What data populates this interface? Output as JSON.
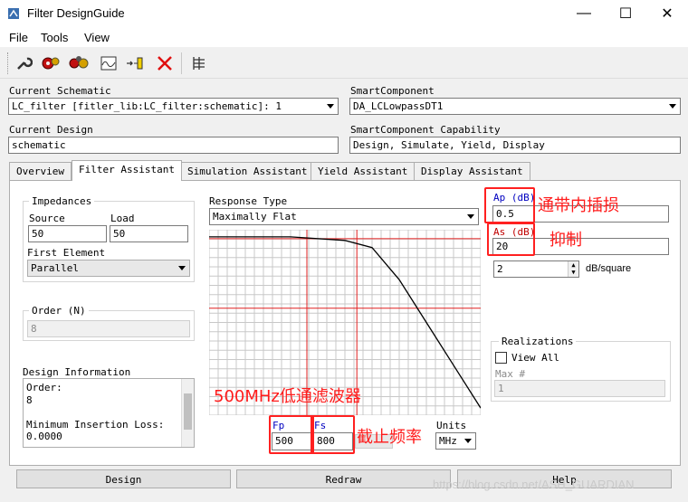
{
  "window": {
    "title": "Filter DesignGuide",
    "minimize": "—",
    "maximize": "☐",
    "close": "✕"
  },
  "menu": {
    "file": "File",
    "tools": "Tools",
    "view": "View"
  },
  "top": {
    "current_schematic_label": "Current Schematic",
    "current_schematic_value": "LC_filter [fitler_lib:LC_filter:schematic]: 1",
    "smart_component_label": "SmartComponent",
    "smart_component_value": "DA_LCLowpassDT1",
    "current_design_label": "Current Design",
    "current_design_value": "schematic",
    "capability_label": "SmartComponent Capability",
    "capability_value": "Design, Simulate, Yield, Display"
  },
  "tabs": [
    "Overview",
    "Filter Assistant",
    "Simulation Assistant",
    "Yield Assistant",
    "Display Assistant"
  ],
  "impedances": {
    "title": "Impedances",
    "source_label": "Source",
    "source_value": "50",
    "load_label": "Load",
    "load_value": "50",
    "first_element_label": "First Element",
    "first_element_value": "Parallel"
  },
  "order": {
    "title": "Order (N)",
    "value": "8"
  },
  "design_info": {
    "title": "Design Information",
    "lines": [
      "Order:",
      "8",
      "",
      "Minimum Insertion Loss:",
      "0.0000"
    ]
  },
  "response": {
    "label": "Response Type",
    "value": "Maximally Flat"
  },
  "params": {
    "ap_label": "Ap (dB)",
    "ap_value": "0.5",
    "as_label": "As (dB)",
    "as_value": "20",
    "slope_value": "2",
    "slope_unit": "dB/square",
    "fp_label": "Fp",
    "fp_value": "500",
    "fs_label": "Fs",
    "fs_value": "800",
    "units_label": "Units",
    "units_value": "MHz"
  },
  "realizations": {
    "title": "Realizations",
    "view_all": "View All",
    "max_label": "Max #",
    "max_value": "1"
  },
  "buttons": {
    "design": "Design",
    "redraw": "Redraw",
    "help": "Help"
  },
  "annotations": {
    "passband": "通带内插损",
    "suppression": "抑制",
    "lowpass": "500MHz低通滤波器",
    "cutoff": "截止频率"
  },
  "watermark": "https://blog.csdn.net/ASH_GUARDIAN",
  "chart_data": {
    "type": "line",
    "title": "",
    "xlabel": "",
    "ylabel": "",
    "series": [
      {
        "x": [
          0,
          0.3,
          0.5,
          0.6,
          0.7,
          0.8,
          0.9,
          1.0
        ],
        "values": [
          0,
          0,
          -1,
          -3,
          -12,
          -24,
          -36,
          -48
        ]
      }
    ],
    "markers": {
      "fp": 500,
      "fs": 800,
      "ap": 0.5,
      "as": 20
    },
    "grid": true
  },
  "colors": {
    "annotation": "#ff1a1a",
    "marker_line": "#e02020",
    "fp_label": "#0000c0"
  }
}
